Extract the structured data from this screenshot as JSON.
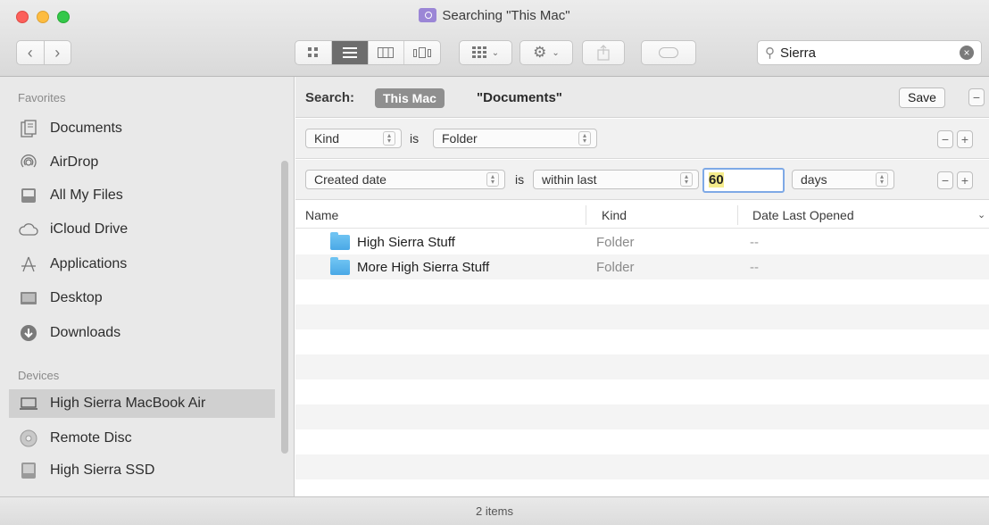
{
  "window": {
    "title": "Searching \"This Mac\""
  },
  "toolbar": {
    "back_icon": "chevron-left-icon",
    "forward_icon": "chevron-right-icon",
    "view_modes": [
      "icon-view",
      "list-view",
      "column-view",
      "cover-flow-view"
    ],
    "active_view": "list-view",
    "search_value": "Sierra"
  },
  "sidebar": {
    "favorites_header": "Favorites",
    "favorites": [
      {
        "label": "Documents",
        "icon": "documents-icon"
      },
      {
        "label": "AirDrop",
        "icon": "airdrop-icon"
      },
      {
        "label": "All My Files",
        "icon": "all-files-icon"
      },
      {
        "label": "iCloud Drive",
        "icon": "cloud-icon"
      },
      {
        "label": "Applications",
        "icon": "applications-icon"
      },
      {
        "label": "Desktop",
        "icon": "desktop-icon"
      },
      {
        "label": "Downloads",
        "icon": "downloads-icon"
      }
    ],
    "devices_header": "Devices",
    "devices": [
      {
        "label": "High Sierra MacBook Air",
        "icon": "laptop-icon",
        "selected": true
      },
      {
        "label": "Remote Disc",
        "icon": "disc-icon"
      },
      {
        "label": "High Sierra SSD",
        "icon": "drive-icon"
      }
    ]
  },
  "search": {
    "label": "Search:",
    "scope_selected": "This Mac",
    "scope_other": "\"Documents\"",
    "save_label": "Save",
    "minus": "−",
    "plus": "+",
    "is_label": "is",
    "criteria": [
      {
        "attribute": "Kind",
        "operator_label": "is",
        "value": "Folder"
      },
      {
        "attribute": "Created date",
        "operator_label": "is",
        "value": "within last",
        "number": "60",
        "unit": "days"
      }
    ]
  },
  "list": {
    "columns": [
      "Name",
      "Kind",
      "Date Last Opened"
    ],
    "rows": [
      {
        "name": "High Sierra Stuff",
        "kind": "Folder",
        "date": "--"
      },
      {
        "name": "More High Sierra Stuff",
        "kind": "Folder",
        "date": "--"
      }
    ]
  },
  "status": {
    "text": "2 items"
  },
  "colors": {
    "folder_blue": "#4aa8e6",
    "selection_gray": "#d0d0d0",
    "field_highlight": "#f5ec8c"
  }
}
